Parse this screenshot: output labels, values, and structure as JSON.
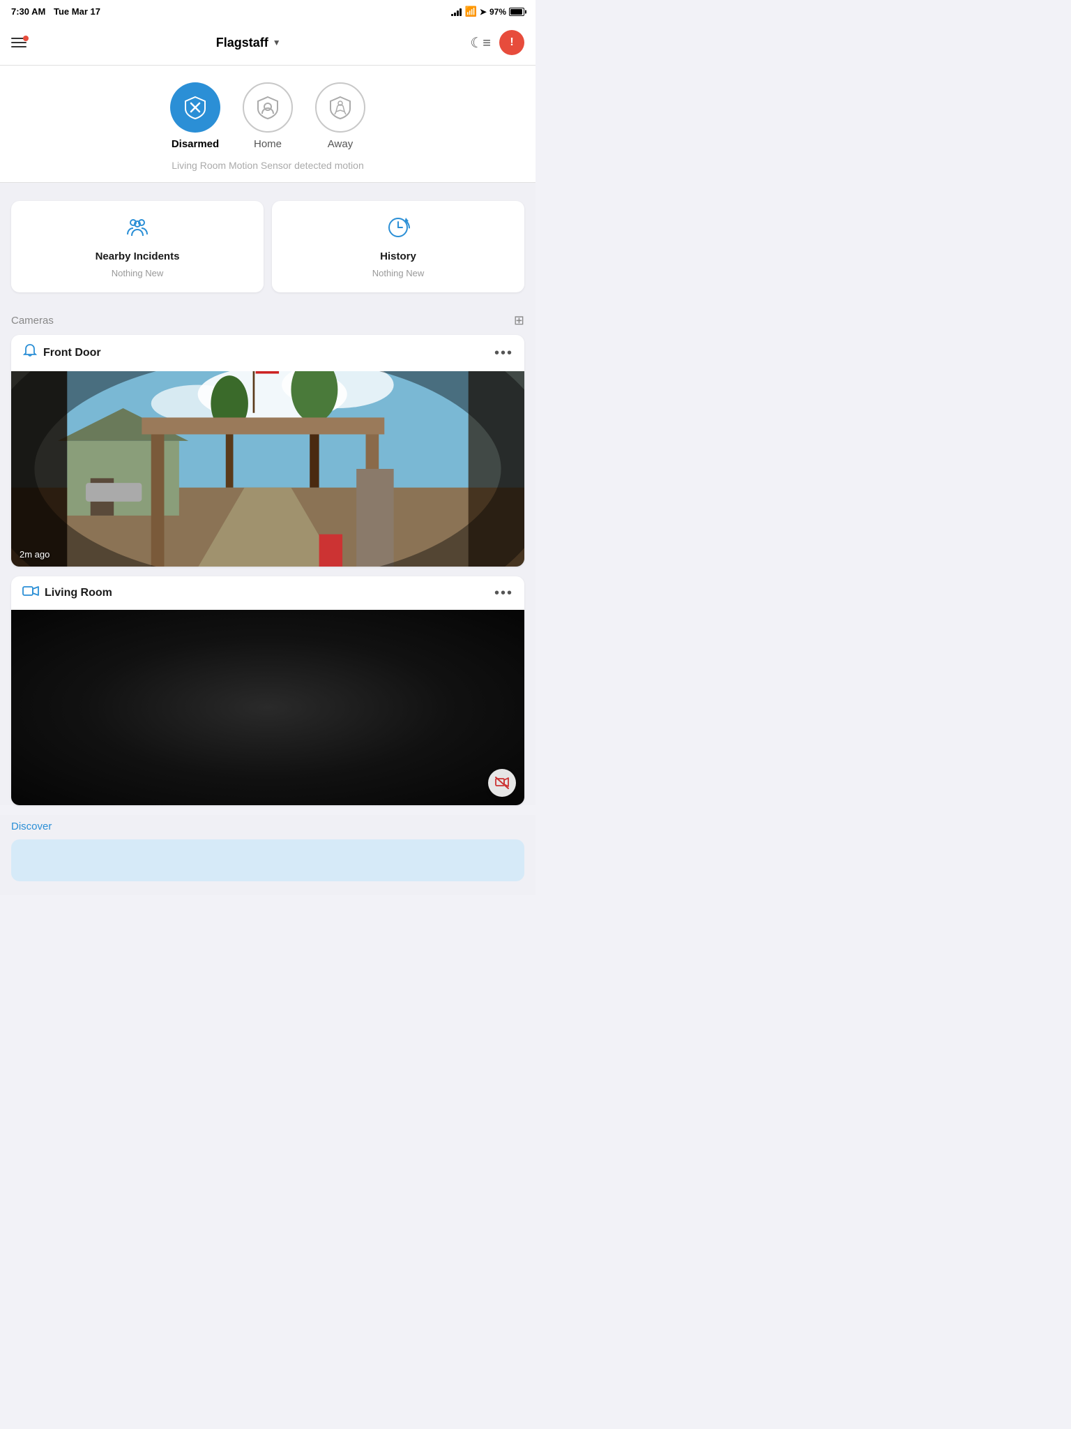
{
  "statusBar": {
    "time": "7:30 AM",
    "date": "Tue Mar 17",
    "battery": "97%"
  },
  "header": {
    "menuLabel": "Menu",
    "location": "Flagstaff",
    "dropdownArrow": "▼",
    "alertLabel": "!"
  },
  "securityModes": {
    "disarmed": {
      "label": "Disarmed",
      "icon": "✕",
      "active": true
    },
    "home": {
      "label": "Home",
      "icon": "👤",
      "active": false
    },
    "away": {
      "label": "Away",
      "icon": "🏃",
      "active": false
    },
    "statusText": "Living Room Motion Sensor detected motion"
  },
  "cards": {
    "nearbyIncidents": {
      "title": "Nearby Incidents",
      "subtitle": "Nothing New",
      "icon": "👥"
    },
    "history": {
      "title": "History",
      "subtitle": "Nothing New",
      "icon": "⏱"
    }
  },
  "cameras": {
    "sectionLabel": "Cameras",
    "gridIconLabel": "grid-view",
    "items": [
      {
        "name": "Front Door",
        "type": "doorbell",
        "timestamp": "2m ago",
        "hasVideo": true
      },
      {
        "name": "Living Room",
        "type": "indoor",
        "timestamp": "",
        "hasVideo": false
      }
    ]
  },
  "discover": {
    "label": "Discover"
  }
}
